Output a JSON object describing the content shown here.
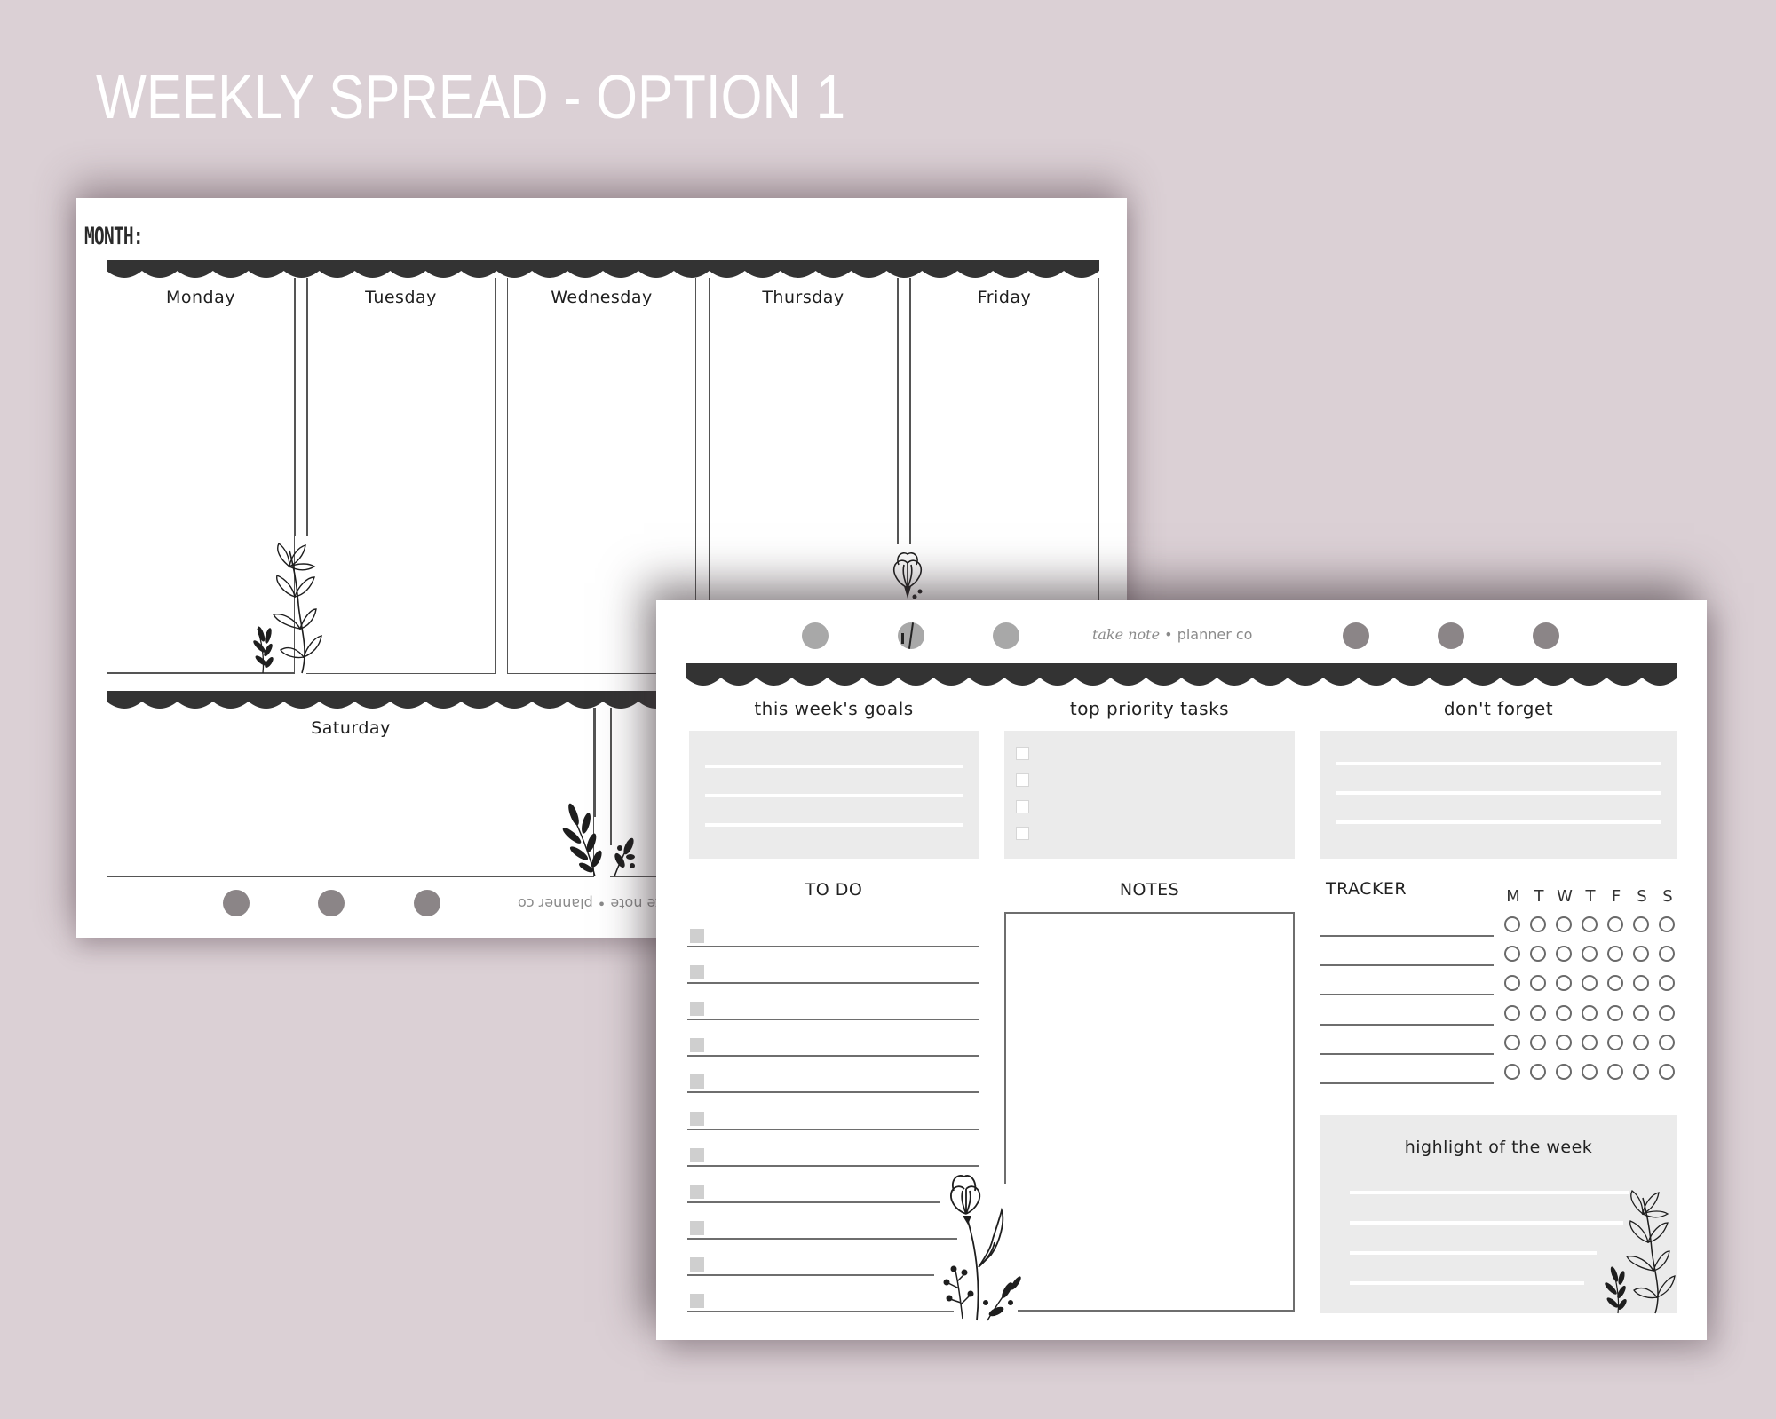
{
  "page_title": "WEEKLY SPREAD - OPTION 1",
  "colors": {
    "background": "#dbd0d5",
    "sheet": "#ffffff",
    "scallop_band": "#333333",
    "gray_box": "#ebebeb",
    "hole_dark": "#8b8587",
    "hole_light": "#a8a8a8",
    "todo_checkbox": "#cfcfcf"
  },
  "sheet1": {
    "month_label": "MONTH:",
    "days_top": [
      "Monday",
      "Tuesday",
      "Wednesday",
      "Thursday",
      "Friday"
    ],
    "days_bottom": [
      "Saturday"
    ],
    "footer_brand": "take note • planner co",
    "footer_brand_orientation": "upside-down",
    "hole_count_visible": 3
  },
  "sheet2": {
    "brand_script": "take note",
    "brand_separator": "•",
    "brand_text": "planner co",
    "hole_count": 6,
    "sections": {
      "goals": {
        "label": "this week's goals",
        "line_count": 3
      },
      "priority": {
        "label": "top priority tasks",
        "checkbox_count": 4
      },
      "dont_forget": {
        "label": "don't forget",
        "line_count": 3
      },
      "todo": {
        "label": "TO DO",
        "row_count": 11
      },
      "notes": {
        "label": "NOTES"
      },
      "tracker": {
        "label": "TRACKER",
        "day_letters": [
          "M",
          "T",
          "W",
          "T",
          "F",
          "S",
          "S"
        ],
        "row_count": 6
      },
      "highlight": {
        "label": "highlight of the week",
        "line_count": 4
      }
    }
  },
  "icons": {
    "sheet1_monday_decoration": "leaf-sprig-icon",
    "sheet1_thursday_decoration": "flower-icon",
    "sheet1_saturday_decoration": "leaf-branch-icon",
    "sheet2_todo_decoration": "flower-stem-icon",
    "sheet2_highlight_decoration": "leaf-sprig-icon"
  }
}
